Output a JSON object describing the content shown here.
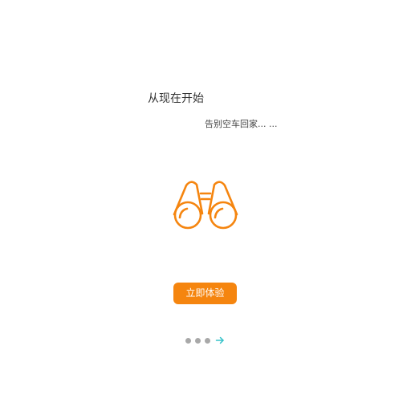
{
  "intro": {
    "headline": "从现在开始",
    "subline": "告别空车回家... ...",
    "hero_icon": "binoculars-icon",
    "cta_label": "立即体验"
  },
  "pager": {
    "page_count": 4,
    "next_icon": "arrow-right-icon"
  },
  "colors": {
    "accent": "#f5850f",
    "dot": "#a8a8a8",
    "arrow": "#35c2c9",
    "text": "#333333"
  }
}
